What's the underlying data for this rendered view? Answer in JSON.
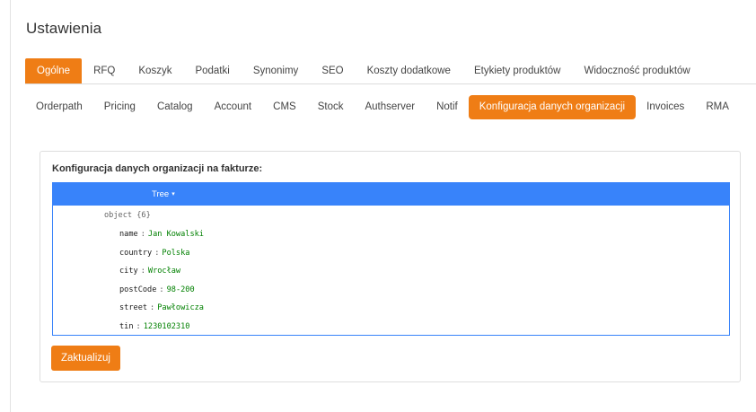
{
  "page": {
    "title": "Ustawienia"
  },
  "tabs_primary": [
    {
      "label": "Ogólne",
      "active": true
    },
    {
      "label": "RFQ",
      "active": false
    },
    {
      "label": "Koszyk",
      "active": false
    },
    {
      "label": "Podatki",
      "active": false
    },
    {
      "label": "Synonimy",
      "active": false
    },
    {
      "label": "SEO",
      "active": false
    },
    {
      "label": "Koszty dodatkowe",
      "active": false
    },
    {
      "label": "Etykiety produktów",
      "active": false
    },
    {
      "label": "Widoczność produktów",
      "active": false
    }
  ],
  "tabs_secondary": [
    {
      "label": "Orderpath",
      "active": false
    },
    {
      "label": "Pricing",
      "active": false
    },
    {
      "label": "Catalog",
      "active": false
    },
    {
      "label": "Account",
      "active": false
    },
    {
      "label": "CMS",
      "active": false
    },
    {
      "label": "Stock",
      "active": false
    },
    {
      "label": "Authserver",
      "active": false
    },
    {
      "label": "Notif",
      "active": false
    },
    {
      "label": "Konfiguracja danych organizacji",
      "active": true
    },
    {
      "label": "Invoices",
      "active": false
    },
    {
      "label": "RMA",
      "active": false
    }
  ],
  "card": {
    "title": "Konfiguracja danych organizacji na fakturze:",
    "editor": {
      "mode_label": "Tree",
      "mode_caret": "▾",
      "root_label": "object {6}",
      "fields": [
        {
          "key": "name",
          "sep": ":",
          "value": "Jan Kowalski",
          "type": "string"
        },
        {
          "key": "country",
          "sep": ":",
          "value": "Polska",
          "type": "string"
        },
        {
          "key": "city",
          "sep": ":",
          "value": "Wrocław",
          "type": "string"
        },
        {
          "key": "postCode",
          "sep": ":",
          "value": "98-200",
          "type": "string"
        },
        {
          "key": "street",
          "sep": ":",
          "value": "Pawłowicza",
          "type": "string"
        },
        {
          "key": "tin",
          "sep": ":",
          "value": "1230102310",
          "type": "string"
        }
      ]
    },
    "update_button": "Zaktualizuj"
  },
  "colors": {
    "accent": "#ef7d15",
    "editor_blue": "#3883fa",
    "string_value": "#008000"
  }
}
